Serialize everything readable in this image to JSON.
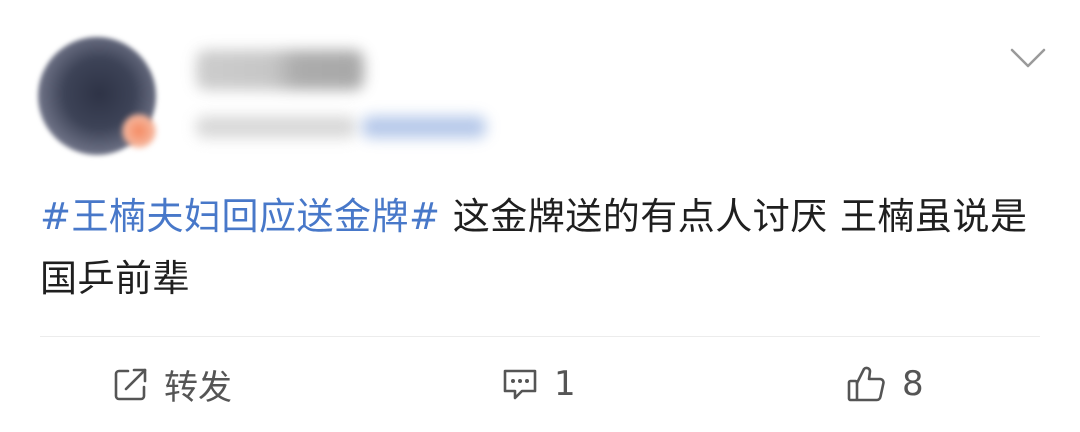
{
  "post": {
    "topic": "#王楠夫妇回应送金牌#",
    "text": " 这金牌送的有点人讨厌 王楠虽说是国乒前辈"
  },
  "actions": {
    "repost_label": "转发",
    "comment_count": "1",
    "like_count": "8"
  },
  "icons": {
    "menu": "chevron-down-icon",
    "repost": "repost-icon",
    "comment": "comment-icon",
    "like": "thumbs-up-icon"
  },
  "colors": {
    "topic": "#4878c9",
    "text": "#1f1f1f",
    "action": "#555555"
  }
}
